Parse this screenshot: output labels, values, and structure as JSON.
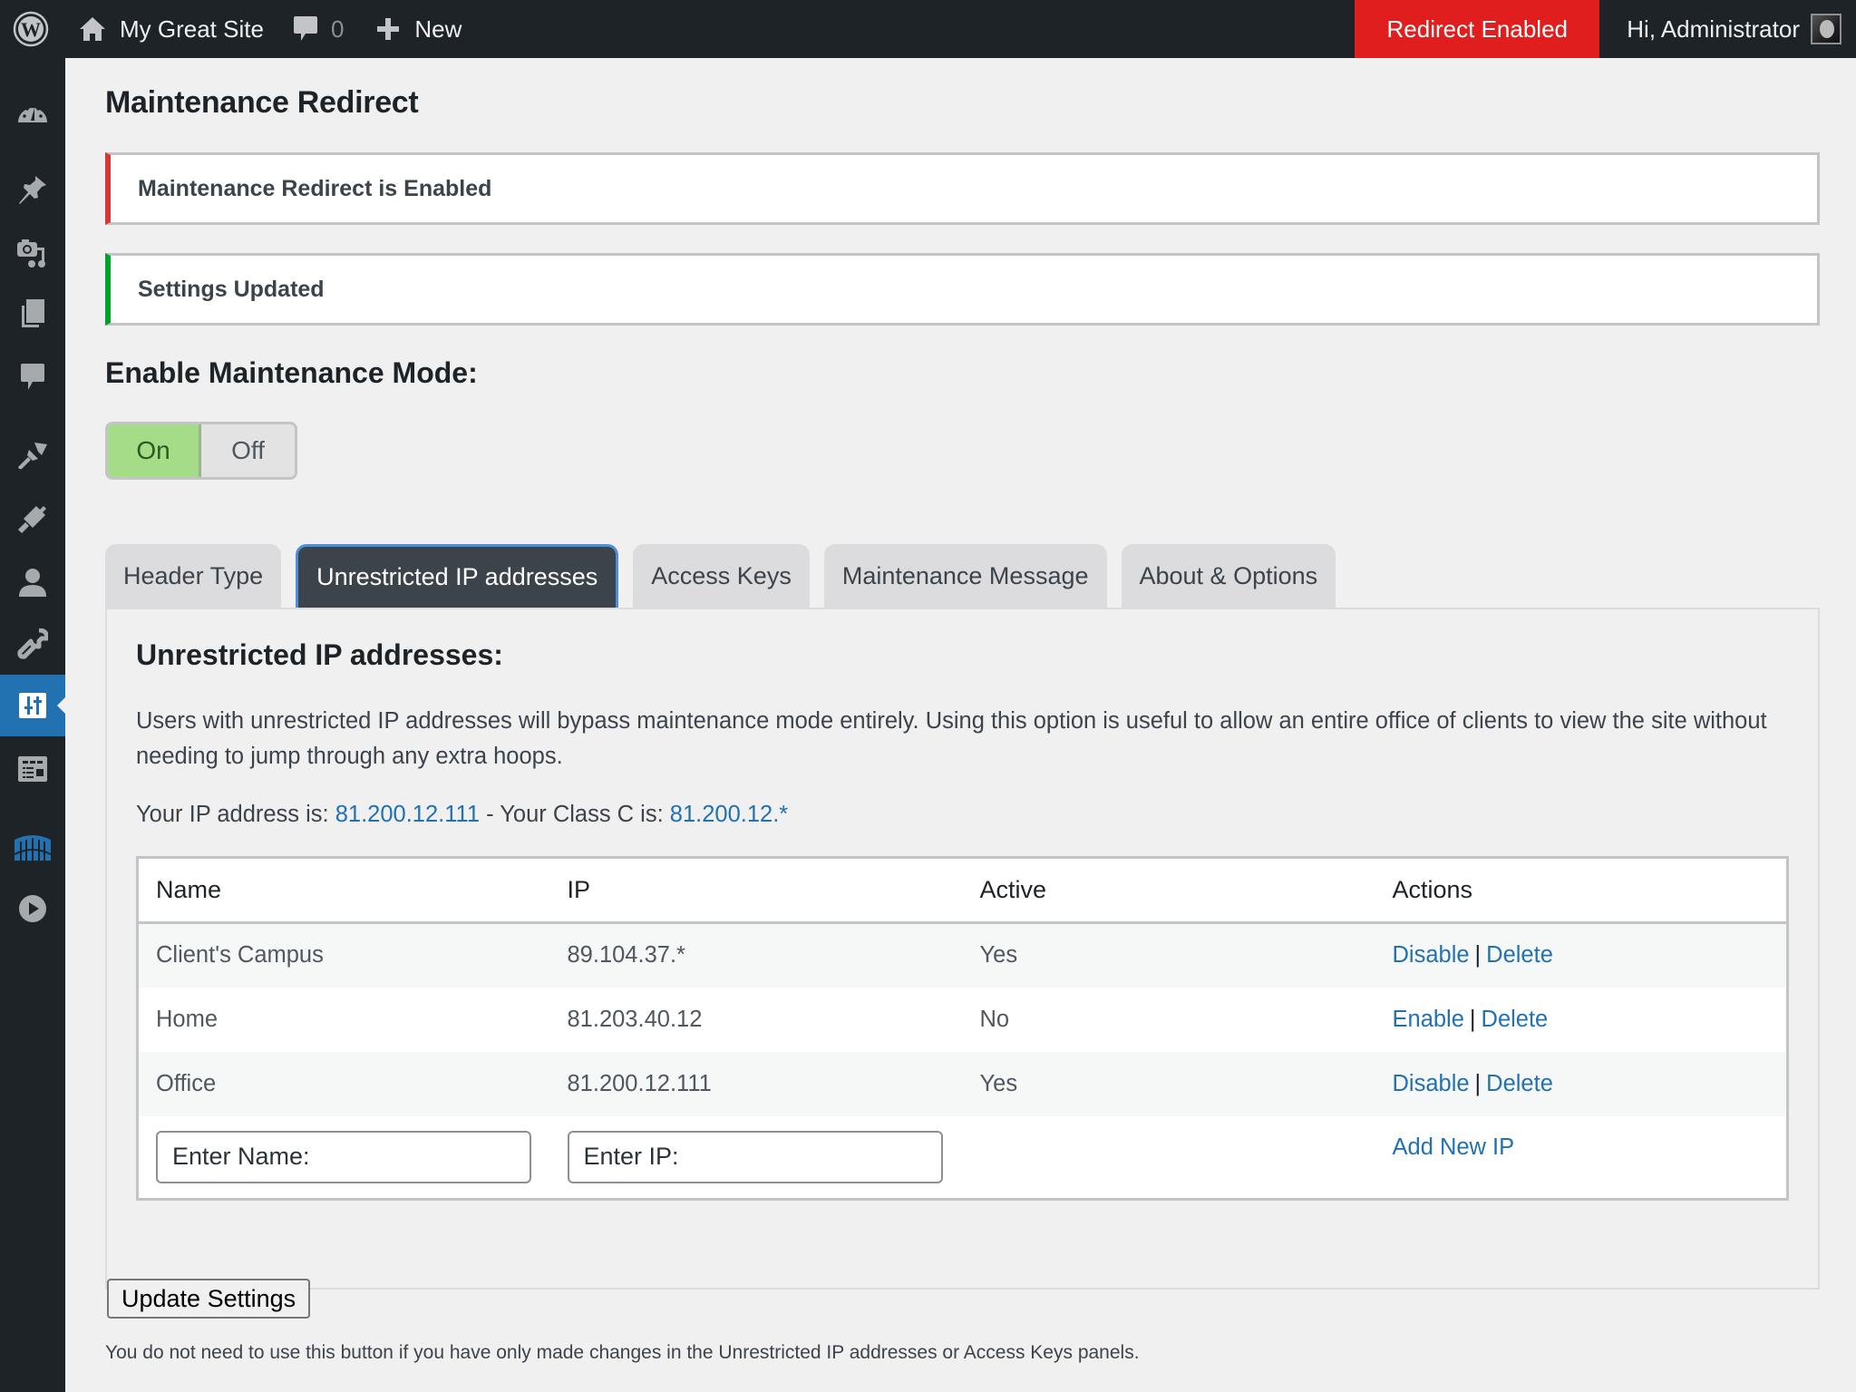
{
  "adminbar": {
    "site_name": "My Great Site",
    "comments_count": "0",
    "new_label": "New",
    "redirect_label": "Redirect Enabled",
    "account_label": "Hi, Administrator",
    "redirect_color": "#e01e1e"
  },
  "sidebar": {
    "items": [
      {
        "name": "dashboard",
        "icon": "dashboard-icon"
      },
      {
        "name": "posts",
        "icon": "pin-icon"
      },
      {
        "name": "media",
        "icon": "media-icon"
      },
      {
        "name": "pages",
        "icon": "pages-icon"
      },
      {
        "name": "comments",
        "icon": "comment-icon"
      },
      {
        "name": "appearance",
        "icon": "paintbrush-icon"
      },
      {
        "name": "plugins",
        "icon": "plugin-icon"
      },
      {
        "name": "users",
        "icon": "user-icon"
      },
      {
        "name": "tools",
        "icon": "wrench-icon"
      },
      {
        "name": "settings",
        "icon": "sliders-icon",
        "current": true
      },
      {
        "name": "layout",
        "icon": "layout-icon"
      },
      {
        "name": "plugin-gate",
        "icon": "gate-icon"
      },
      {
        "name": "media-player",
        "icon": "play-icon"
      }
    ]
  },
  "page": {
    "title": "Maintenance Redirect",
    "notice_enabled": "Maintenance Redirect is Enabled",
    "notice_updated": "Settings Updated",
    "mode_heading": "Enable Maintenance Mode:",
    "toggle": {
      "on_label": "On",
      "off_label": "Off",
      "selected": "On"
    }
  },
  "tabs": [
    {
      "label": "Header Type",
      "active": false
    },
    {
      "label": "Unrestricted IP addresses",
      "active": true
    },
    {
      "label": "Access Keys",
      "active": false
    },
    {
      "label": "Maintenance Message",
      "active": false
    },
    {
      "label": "About & Options",
      "active": false
    }
  ],
  "panel": {
    "title": "Unrestricted IP addresses:",
    "description": "Users with unrestricted IP addresses will bypass maintenance mode entirely. Using this option is useful to allow an entire office of clients to view the site without needing to jump through any extra hoops.",
    "ip_prefix": "Your IP address is: ",
    "ip_value": "81.200.12.111",
    "classc_prefix": " - Your Class C is: ",
    "classc_value": "81.200.12.*",
    "table": {
      "headers": [
        "Name",
        "IP",
        "Active",
        "Actions"
      ],
      "rows": [
        {
          "name": "Client's Campus",
          "ip": "89.104.37.*",
          "active": "Yes",
          "toggle_action": "Disable",
          "delete_action": "Delete"
        },
        {
          "name": "Home",
          "ip": "81.203.40.12",
          "active": "No",
          "toggle_action": "Enable",
          "delete_action": "Delete"
        },
        {
          "name": "Office",
          "ip": "81.200.12.111",
          "active": "Yes",
          "toggle_action": "Disable",
          "delete_action": "Delete"
        }
      ],
      "separator": "|",
      "name_placeholder": "Enter Name:",
      "ip_placeholder": "Enter IP:",
      "add_label": "Add New IP"
    }
  },
  "footer": {
    "update_label": "Update Settings",
    "note": "You do not need to use this button if you have only made changes in the Unrestricted IP addresses or Access Keys panels."
  }
}
